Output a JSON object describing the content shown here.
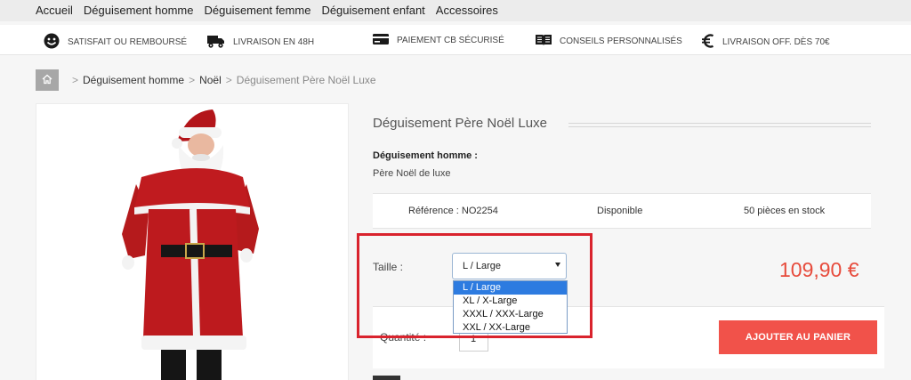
{
  "nav": {
    "items": [
      {
        "label": "Accueil"
      },
      {
        "label": "Déguisement homme"
      },
      {
        "label": "Déguisement femme"
      },
      {
        "label": "Déguisement enfant"
      },
      {
        "label": "Accessoires"
      }
    ]
  },
  "features": {
    "items": [
      {
        "label": "SATISFAIT OU REMBOURSÉ",
        "icon": "smiley-icon"
      },
      {
        "label": "LIVRAISON EN 48H",
        "icon": "delivery-truck-icon"
      },
      {
        "label": "PAIEMENT CB SÉCURISÉ",
        "icon": "credit-card-icon"
      },
      {
        "label": "CONSEILS PERSONNALISÉS",
        "icon": "open-book-icon"
      },
      {
        "label": "LIVRAISON OFF. DÈS 70€",
        "icon": "euro-icon"
      }
    ]
  },
  "breadcrumb": {
    "sep": ">",
    "items": [
      {
        "label": "Déguisement homme"
      },
      {
        "label": "Noël"
      },
      {
        "label": "Déguisement Père Noël Luxe"
      }
    ]
  },
  "product": {
    "title": "Déguisement Père Noël Luxe",
    "category_label": "Déguisement homme :",
    "category_desc": "Père Noël de luxe",
    "reference": "Référence : NO2254",
    "availability": "Disponible",
    "stock": "50 pièces en stock",
    "price": "109,90 €"
  },
  "size": {
    "label": "Taille :",
    "selected": "L / Large",
    "options": [
      {
        "label": "L / Large"
      },
      {
        "label": "XL / X-Large"
      },
      {
        "label": "XXXL / XXX-Large"
      },
      {
        "label": "XXL / XX-Large"
      }
    ]
  },
  "quantity": {
    "label": "Quantité :",
    "value": "1"
  },
  "cart": {
    "button_label": "AJOUTER AU PANIER"
  },
  "colors": {
    "accent": "#f1524a",
    "price": "#e74b3c",
    "highlight": "#d9232d",
    "selected_option": "#2d7be0"
  }
}
